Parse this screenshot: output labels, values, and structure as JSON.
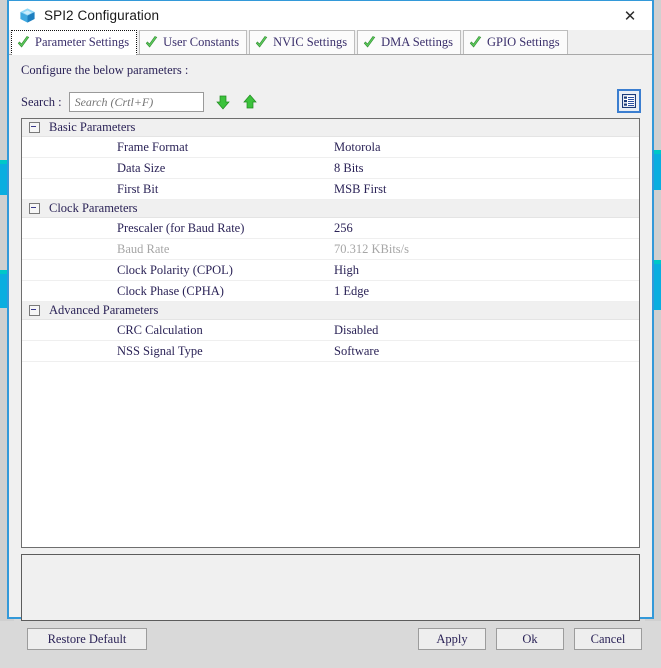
{
  "window": {
    "title": "SPI2 Configuration",
    "app_icon": "cube-icon",
    "close_label": "✕"
  },
  "tabs": [
    {
      "label": "Parameter Settings",
      "icon": "green-check-icon",
      "selected": true
    },
    {
      "label": "User Constants",
      "icon": "green-check-icon",
      "selected": false
    },
    {
      "label": "NVIC Settings",
      "icon": "green-check-icon",
      "selected": false
    },
    {
      "label": "DMA Settings",
      "icon": "green-check-icon",
      "selected": false
    },
    {
      "label": "GPIO Settings",
      "icon": "green-check-icon",
      "selected": false
    }
  ],
  "body": {
    "configure_label": "Configure the below parameters :",
    "search": {
      "label": "Search :",
      "value": "",
      "placeholder": "Search (Crtl+F)"
    },
    "search_next_icon": "arrow-down-icon",
    "search_prev_icon": "arrow-up-icon",
    "view_toggle_icon": "list-view-icon"
  },
  "param_groups": [
    {
      "title": "Basic Parameters",
      "expanded": true,
      "rows": [
        {
          "name": "Frame Format",
          "value": "Motorola",
          "disabled": false
        },
        {
          "name": "Data Size",
          "value": "8 Bits",
          "disabled": false
        },
        {
          "name": "First Bit",
          "value": "MSB First",
          "disabled": false
        }
      ]
    },
    {
      "title": "Clock Parameters",
      "expanded": true,
      "rows": [
        {
          "name": "Prescaler (for Baud Rate)",
          "value": "256",
          "disabled": false
        },
        {
          "name": "Baud Rate",
          "value": "70.312 KBits/s",
          "disabled": true
        },
        {
          "name": "Clock Polarity (CPOL)",
          "value": "High",
          "disabled": false
        },
        {
          "name": "Clock Phase (CPHA)",
          "value": "1 Edge",
          "disabled": false
        }
      ]
    },
    {
      "title": "Advanced Parameters",
      "expanded": true,
      "rows": [
        {
          "name": "CRC Calculation",
          "value": "Disabled",
          "disabled": false
        },
        {
          "name": "NSS Signal Type",
          "value": "Software",
          "disabled": false
        }
      ]
    }
  ],
  "description_panel": {
    "text": ""
  },
  "buttons": {
    "restore_default": "Restore Default",
    "apply": "Apply",
    "ok": "Ok",
    "cancel": "Cancel"
  },
  "colors": {
    "dialog_border": "#3399d9",
    "label_text": "#2b2357",
    "disabled_text": "#a6a6a6",
    "group_row_bg": "#f0f0f0",
    "check_green": "#4cc24c",
    "arrow_green": "#3cc23c",
    "toggle_border": "#3b7ed0",
    "bg_app_blue": "#0aaee0"
  }
}
